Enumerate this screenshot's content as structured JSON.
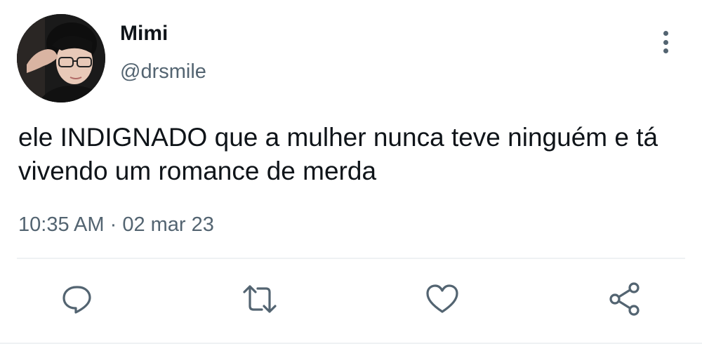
{
  "user": {
    "display_name": "Mimi",
    "handle": "@drsmile"
  },
  "tweet": {
    "text": "ele INDIGNADO que a mulher nunca teve ninguém e tá vivendo um romance de merda",
    "time": "10:35 AM",
    "separator": "·",
    "date": "02 mar 23"
  },
  "actions": {
    "icons": [
      "reply-icon",
      "retweet-icon",
      "like-icon",
      "share-icon"
    ]
  },
  "colors": {
    "primary_text": "#0f1419",
    "secondary_text": "#536471",
    "divider": "#eef1f3",
    "background": "#ffffff"
  }
}
